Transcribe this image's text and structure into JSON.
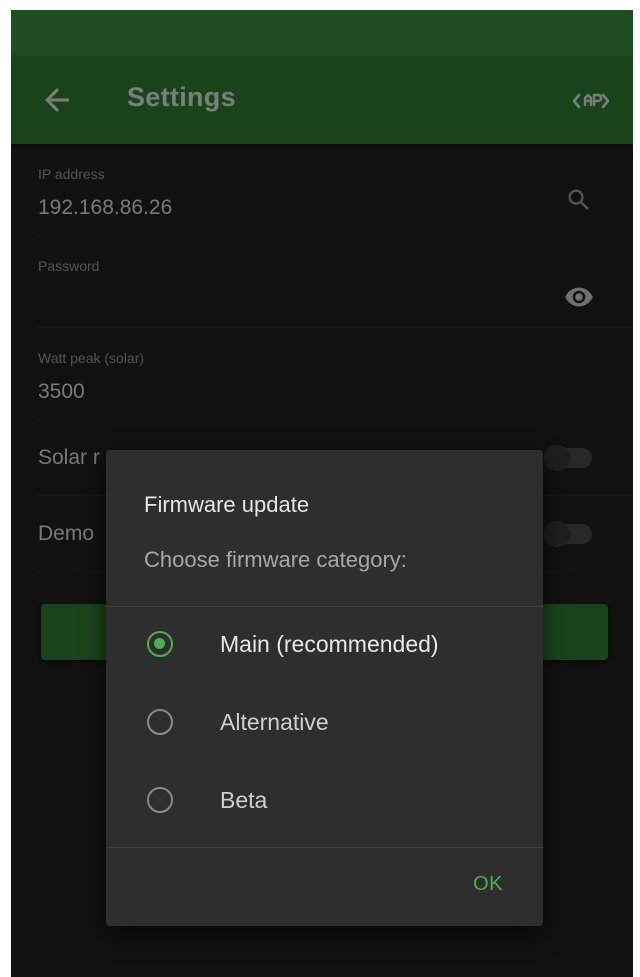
{
  "appbar": {
    "title": "Settings",
    "back_icon": "arrow-back-icon",
    "action_icon": "api-icon"
  },
  "settings": {
    "ip": {
      "label": "IP address",
      "value": "192.168.86.26",
      "icon": "search-icon"
    },
    "password": {
      "label": "Password",
      "value": "",
      "icon": "eye-icon"
    },
    "watt_peak": {
      "label": "Watt peak (solar)",
      "value": "3500"
    },
    "solar_mode": {
      "label": "Solar mode",
      "visible_label": "Solar r",
      "enabled": false
    },
    "demo_mode": {
      "label": "Demo",
      "enabled": false
    }
  },
  "dialog": {
    "title": "Firmware update",
    "message": "Choose firmware category:",
    "options": [
      {
        "label": "Main (recommended)",
        "selected": true
      },
      {
        "label": "Alternative",
        "selected": false
      },
      {
        "label": "Beta",
        "selected": false
      }
    ],
    "ok_label": "OK"
  },
  "colors": {
    "statusbar": "#388e3c",
    "appbar": "#2e7d32",
    "accent": "#4caf50",
    "background": "#1f1f1f",
    "dialog": "#2e2e2e"
  }
}
